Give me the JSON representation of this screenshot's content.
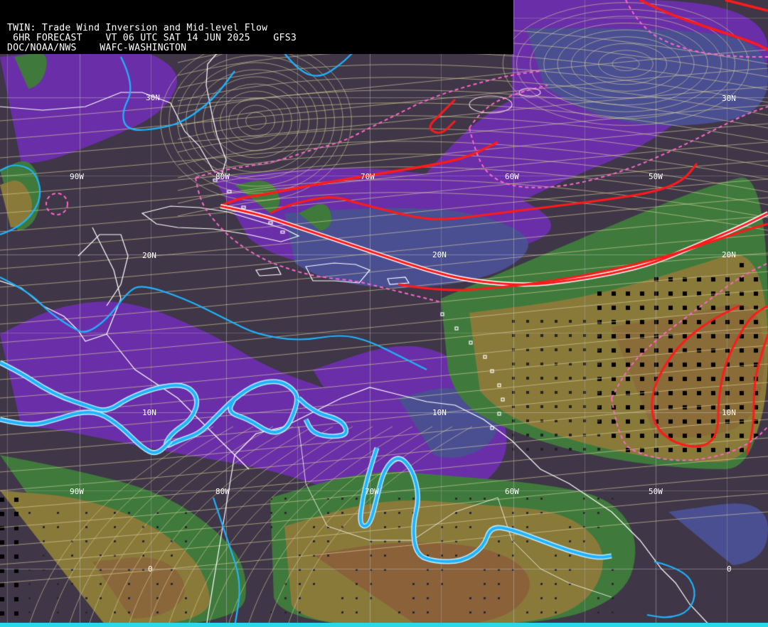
{
  "header": {
    "line1": "TWIN: Trade Wind Inversion and Mid-level Flow",
    "line2": " 6HR FORECAST    VT 06 UTC SAT 14 JUN 2025    GFS3",
    "line3": "DOC/NOAA/NWS    WAFC-WASHINGTON"
  },
  "grid_labels": {
    "lat_30n_left": "30N",
    "lat_30n_right": "30N",
    "lat_20n_left": "20N",
    "lat_20n_mid": "20N",
    "lat_20n_right": "20N",
    "lat_10n_left": "10N",
    "lat_10n_mid": "10N",
    "lat_10n_right": "10N",
    "lat_0_left": "0",
    "lat_0_right": "0",
    "lon_90w_top": "90W",
    "lon_80w_top": "80W",
    "lon_70w_top": "70W",
    "lon_60w_top": "60W",
    "lon_50w_top": "50W",
    "lon_90w_bottom": "90W",
    "lon_80w_bottom": "80W",
    "lon_70w_bottom": "70W",
    "lon_60w_bottom": "60W",
    "lon_50w_bottom": "50W"
  },
  "colors": {
    "background": "#3f3747",
    "purple_band": "#6a2fa8",
    "blue_band": "#4a4f92",
    "green_band": "#3f7a3c",
    "olive_band": "#8a7a3a",
    "brown_band": "#8a5a3a",
    "streamline": "#d9cf9a",
    "coastline": "#ffffff",
    "cyan_contour": "#1fb4ff",
    "red_contour": "#ff1a1a",
    "pink_dashed": "#ff66cc",
    "grid": "#c8c8c8"
  }
}
